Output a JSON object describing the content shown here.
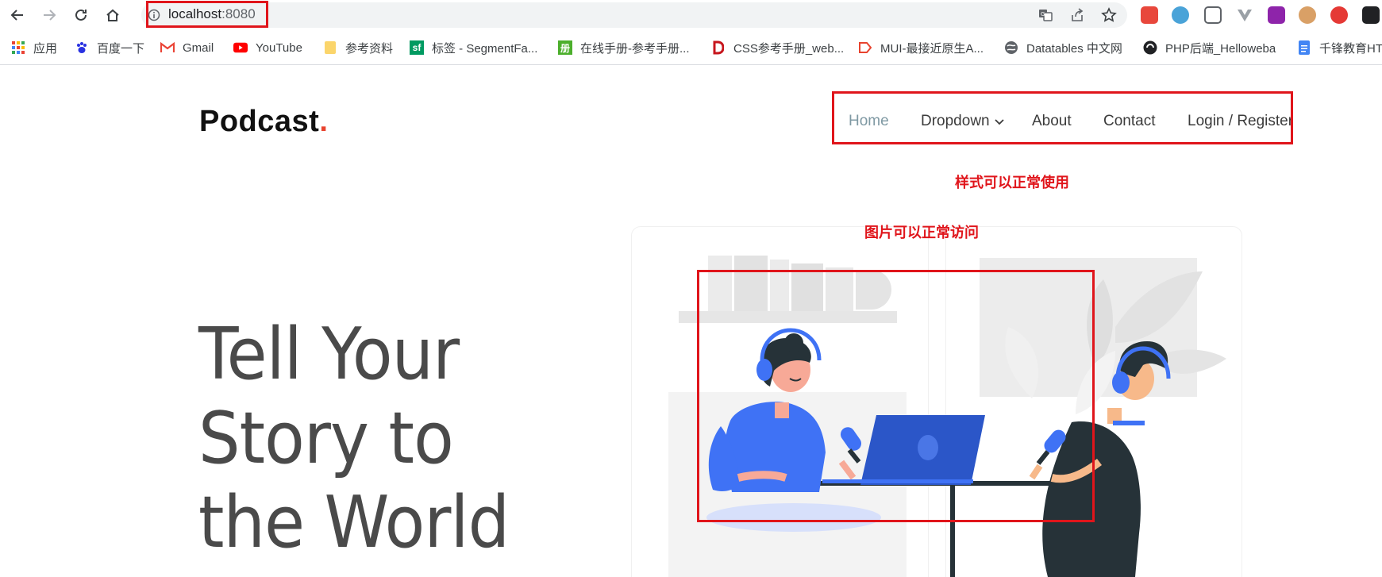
{
  "browser": {
    "url_host": "localhost",
    "url_port": ":8080",
    "nav": {
      "back_icon": "arrow-left-icon",
      "forward_icon": "arrow-right-icon",
      "reload_icon": "reload-icon",
      "home_icon": "home-icon"
    },
    "actions": [
      "translate-icon",
      "share-icon",
      "bookmark-star-icon"
    ],
    "bookmarks": [
      {
        "label": "应用",
        "icon": "apps-grid-icon"
      },
      {
        "label": "百度一下",
        "icon": "baidu-paw-icon"
      },
      {
        "label": "Gmail",
        "icon": "gmail-icon"
      },
      {
        "label": "YouTube",
        "icon": "youtube-icon"
      },
      {
        "label": "参考资料",
        "icon": "folder-icon"
      },
      {
        "label": "标签 - SegmentFa...",
        "icon": "segmentfault-icon",
        "glyph": "sf"
      },
      {
        "label": "在线手册-参考手册...",
        "icon": "manual-icon",
        "glyph": "册"
      },
      {
        "label": "CSS参考手册_web...",
        "icon": "css-manual-icon"
      },
      {
        "label": "MUI-最接近原生A...",
        "icon": "mui-icon"
      },
      {
        "label": "Datatables 中文网",
        "icon": "datatables-icon"
      },
      {
        "label": "PHP后端_Helloweba",
        "icon": "helloweba-icon"
      },
      {
        "label": "千锋教育HT",
        "icon": "doc-icon"
      }
    ]
  },
  "site": {
    "brand": "Podcast",
    "brand_dot": ".",
    "nav": [
      {
        "label": "Home",
        "active": true
      },
      {
        "label": "Dropdown",
        "active": false
      },
      {
        "label": "About",
        "active": false
      },
      {
        "label": "Contact",
        "active": false
      },
      {
        "label": "Login / Register",
        "active": false
      }
    ],
    "hero": [
      "Tell Your",
      "Story to",
      "the World"
    ]
  },
  "annotations": {
    "style_note": "样式可以正常使用",
    "image_note": "图片可以正常访问"
  },
  "colors": {
    "highlight": "#e0151b",
    "brand_dot": "#e8432e",
    "nav_active": "#7f99a3",
    "illustration_blue": "#3f72f5"
  }
}
